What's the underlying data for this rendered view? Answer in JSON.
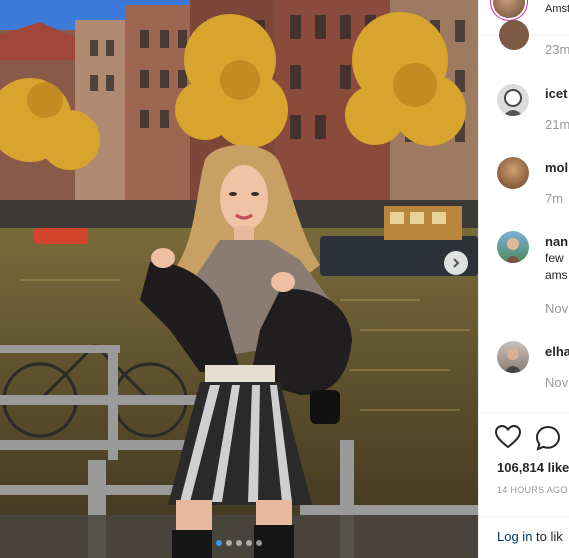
{
  "post": {
    "location": "Amst",
    "header_time": "23m",
    "slides": 5,
    "active_slide": 1
  },
  "comments": [
    {
      "username": "icet",
      "text": "",
      "time": "21m"
    },
    {
      "username": "mol",
      "text": "",
      "time": "7m"
    },
    {
      "username": "nan",
      "text_lines": [
        "few",
        "ams"
      ],
      "time": "Nov"
    },
    {
      "username": "elha",
      "text": "",
      "time": "Nov"
    }
  ],
  "actions": {
    "like_icon": "heart-icon",
    "comment_icon": "comment-icon"
  },
  "likes": "106,814 like",
  "posted_ago": "14 HOURS AGO",
  "login": {
    "link": "Log in",
    "rest": "to lik"
  },
  "colors": {
    "accent": "#3897f0",
    "link": "#003569",
    "muted": "#999999"
  }
}
